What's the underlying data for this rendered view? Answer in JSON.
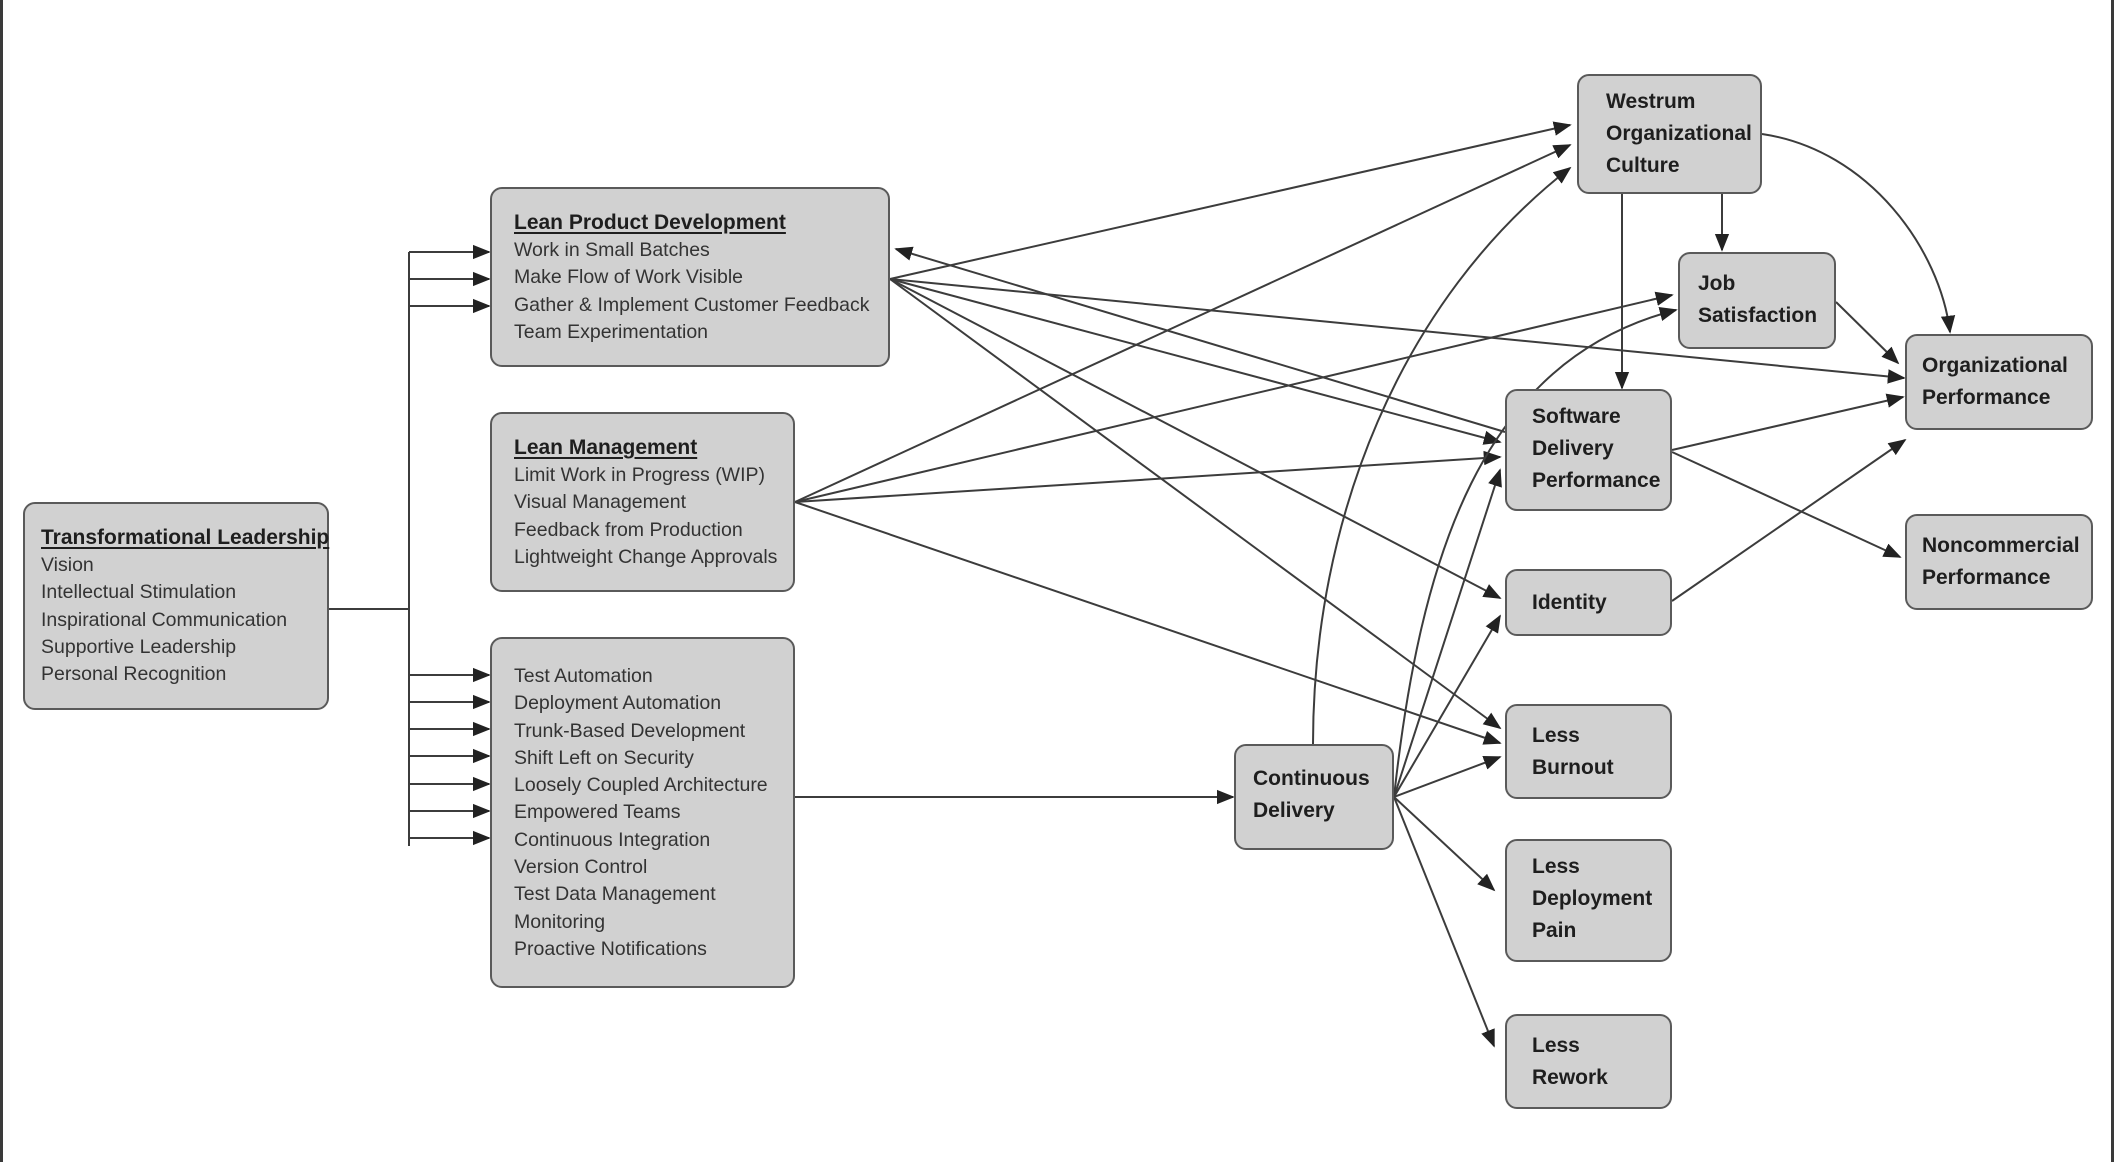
{
  "diagram": {
    "colors": {
      "background": "#ffffff",
      "node_fill": "#d1d1d1",
      "node_border": "#5a5a5a",
      "edge": "#3c3c3c",
      "text": "#1e1e1e"
    },
    "nodes": {
      "transformational_leadership": {
        "title": "Transformational Leadership",
        "items": [
          "Vision",
          "Intellectual Stimulation",
          "Inspirational Communication",
          "Supportive Leadership",
          "Personal Recognition"
        ]
      },
      "lean_product_development": {
        "title": "Lean Product Development",
        "items": [
          "Work in Small Batches",
          "Make Flow of Work Visible",
          "Gather & Implement Customer Feedback",
          "Team Experimentation"
        ]
      },
      "lean_management": {
        "title": "Lean Management",
        "items": [
          "Limit Work in Progress (WIP)",
          "Visual Management",
          "Feedback from Production",
          "Lightweight Change Approvals"
        ]
      },
      "technical_practices": {
        "items": [
          "Test Automation",
          "Deployment Automation",
          "Trunk-Based Development",
          "Shift Left on Security",
          "Loosely Coupled Architecture",
          "Empowered Teams",
          "Continuous Integration",
          "Version Control",
          "Test Data Management",
          "Monitoring",
          "Proactive Notifications"
        ]
      },
      "continuous_delivery": {
        "lines": [
          "Continuous",
          "Delivery"
        ]
      },
      "westrum_culture": {
        "lines": [
          "Westrum",
          "Organizational",
          "Culture"
        ]
      },
      "job_satisfaction": {
        "lines": [
          "Job",
          "Satisfaction"
        ]
      },
      "software_delivery_performance": {
        "lines": [
          "Software",
          "Delivery",
          "Performance"
        ]
      },
      "identity": {
        "lines": [
          "Identity"
        ]
      },
      "less_burnout": {
        "lines": [
          "Less",
          "Burnout"
        ]
      },
      "less_deployment_pain": {
        "lines": [
          "Less",
          "Deployment",
          "Pain"
        ]
      },
      "less_rework": {
        "lines": [
          "Less",
          "Rework"
        ]
      },
      "organizational_performance": {
        "lines": [
          "Organizational",
          "Performance"
        ]
      },
      "noncommercial_performance": {
        "lines": [
          "Noncommercial",
          "Performance"
        ]
      }
    },
    "edges": [
      {
        "from": "transformational_leadership",
        "to": "lean_product_development",
        "count": 3
      },
      {
        "from": "transformational_leadership",
        "to": "technical_practices",
        "count": 7
      },
      {
        "from": "technical_practices",
        "to": "continuous_delivery"
      },
      {
        "from": "lean_product_development",
        "to": "westrum_culture"
      },
      {
        "from": "lean_product_development",
        "to": "organizational_performance"
      },
      {
        "from": "lean_product_development",
        "to": "software_delivery_performance"
      },
      {
        "from": "lean_product_development",
        "to": "identity"
      },
      {
        "from": "lean_product_development",
        "to": "less_burnout"
      },
      {
        "from": "software_delivery_performance",
        "to": "lean_product_development"
      },
      {
        "from": "lean_management",
        "to": "westrum_culture"
      },
      {
        "from": "lean_management",
        "to": "job_satisfaction"
      },
      {
        "from": "lean_management",
        "to": "software_delivery_performance"
      },
      {
        "from": "lean_management",
        "to": "less_burnout"
      },
      {
        "from": "continuous_delivery",
        "to": "westrum_culture"
      },
      {
        "from": "continuous_delivery",
        "to": "job_satisfaction"
      },
      {
        "from": "continuous_delivery",
        "to": "software_delivery_performance"
      },
      {
        "from": "continuous_delivery",
        "to": "identity"
      },
      {
        "from": "continuous_delivery",
        "to": "less_burnout"
      },
      {
        "from": "continuous_delivery",
        "to": "less_deployment_pain"
      },
      {
        "from": "continuous_delivery",
        "to": "less_rework"
      },
      {
        "from": "westrum_culture",
        "to": "job_satisfaction"
      },
      {
        "from": "westrum_culture",
        "to": "software_delivery_performance"
      },
      {
        "from": "westrum_culture",
        "to": "organizational_performance"
      },
      {
        "from": "job_satisfaction",
        "to": "organizational_performance"
      },
      {
        "from": "software_delivery_performance",
        "to": "organizational_performance"
      },
      {
        "from": "software_delivery_performance",
        "to": "noncommercial_performance"
      },
      {
        "from": "identity",
        "to": "organizational_performance"
      }
    ]
  }
}
